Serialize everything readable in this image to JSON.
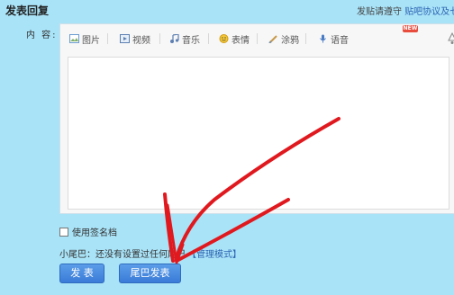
{
  "header": {
    "title": "发表回复",
    "rules_prefix": "发贴请遵守",
    "rules_link": "贴吧协议及七"
  },
  "content_label": "内 容:",
  "toolbar": {
    "items": [
      {
        "label": "图片",
        "icon": "image-icon"
      },
      {
        "label": "视频",
        "icon": "video-icon"
      },
      {
        "label": "音乐",
        "icon": "music-icon"
      },
      {
        "label": "表情",
        "icon": "emoji-icon"
      },
      {
        "label": "涂鸦",
        "icon": "brush-icon"
      },
      {
        "label": "语音",
        "icon": "microphone-icon"
      }
    ],
    "badge": "NEW"
  },
  "editor": {
    "value": ""
  },
  "signature": {
    "label": "使用签名档",
    "checked": false
  },
  "tail": {
    "text": "小尾巴：还没有设置过任何尾巴",
    "mode_link": "【管理模式】"
  },
  "buttons": {
    "post": "发 表",
    "tail_post": "尾巴发表"
  },
  "colors": {
    "background": "#a9e3f7",
    "button": "#3a7bd8",
    "annotation": "#e0191f"
  }
}
